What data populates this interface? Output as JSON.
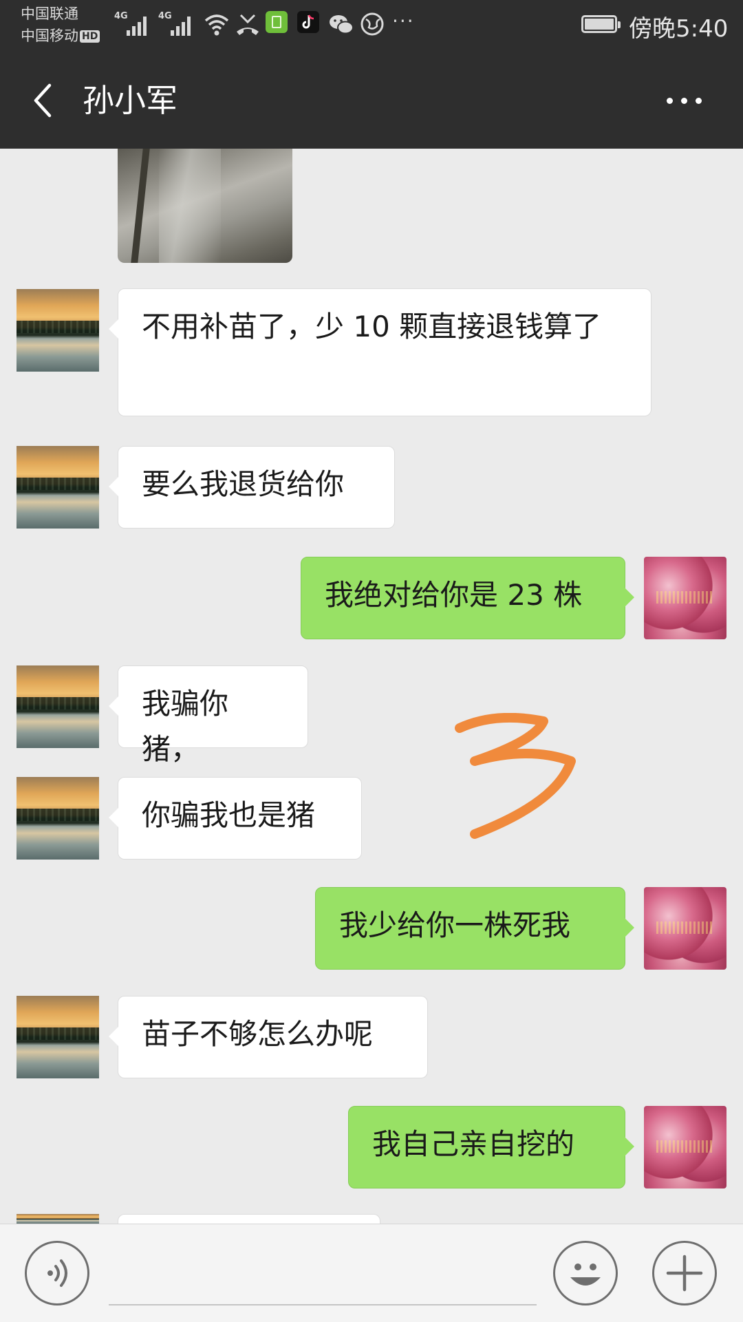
{
  "status_bar": {
    "carrier_1": "中国联通",
    "carrier_2": "中国移动",
    "hd_badge": "HD",
    "signal_1_label": "4G",
    "signal_2_label": "4G",
    "icons": [
      "wifi-icon",
      "missed-call-icon",
      "clipboard-app-icon",
      "tiktok-icon",
      "wechat-icon",
      "browser-icon"
    ],
    "more": "···",
    "time": "傍晚5:40"
  },
  "header": {
    "title": "孙小军"
  },
  "messages": [
    {
      "side": "left",
      "type": "image"
    },
    {
      "side": "left",
      "text": "不用补苗了，少 10 颗直接退钱算了"
    },
    {
      "side": "left",
      "text": "要么我退货给你"
    },
    {
      "side": "right",
      "text": "我绝对给你是 23 株"
    },
    {
      "side": "left",
      "text": "我骗你猪，"
    },
    {
      "side": "left",
      "text": "你骗我也是猪"
    },
    {
      "side": "right",
      "text": "我少给你一株死我"
    },
    {
      "side": "left",
      "text": "苗子不够怎么办呢"
    },
    {
      "side": "right",
      "text": "我自己亲自挖的"
    },
    {
      "side": "left",
      "type": "partial"
    }
  ],
  "annotation": {
    "drawn_mark": "3",
    "color": "#f08a3c"
  },
  "colors": {
    "header_bg": "#2e2e2e",
    "chat_bg": "#ebebeb",
    "sent_bubble": "#98e165",
    "received_bubble": "#ffffff"
  },
  "input_bar": {
    "voice_icon": "voice-icon",
    "emoji_icon": "emoji-icon",
    "plus_icon": "plus-icon"
  }
}
